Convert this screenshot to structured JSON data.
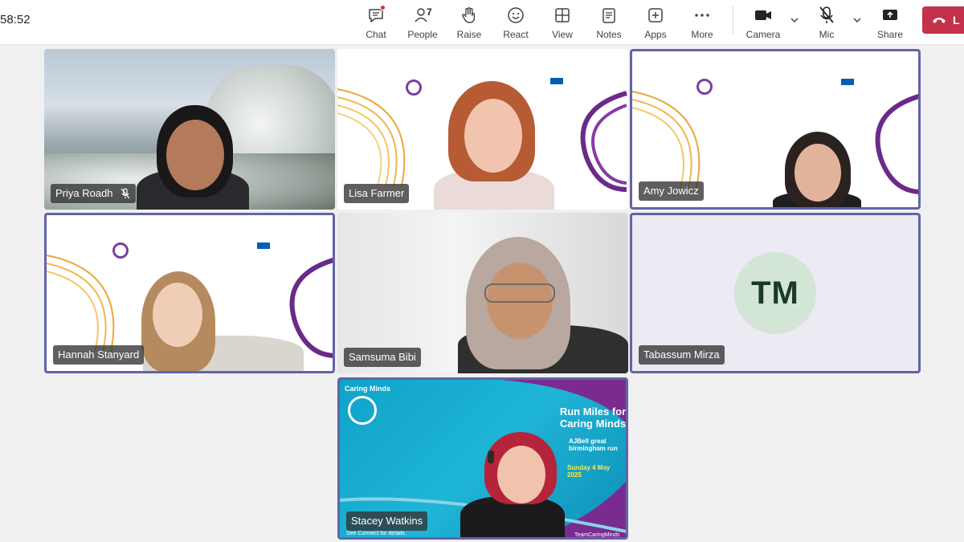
{
  "meeting": {
    "timer": "58:52"
  },
  "toolbar": {
    "chat_label": "Chat",
    "people_label": "People",
    "people_count": "7",
    "raise_label": "Raise",
    "react_label": "React",
    "view_label": "View",
    "notes_label": "Notes",
    "apps_label": "Apps",
    "more_label": "More",
    "camera_label": "Camera",
    "mic_label": "Mic",
    "share_label": "Share",
    "leave_label": "L"
  },
  "participants": [
    {
      "name": "Priya Roadh",
      "muted": true
    },
    {
      "name": "Lisa Farmer",
      "muted": false
    },
    {
      "name": "Amy Jowicz",
      "muted": false
    },
    {
      "name": "Hannah Stanyard",
      "muted": false
    },
    {
      "name": "Samsuma Bibi",
      "muted": false
    },
    {
      "name": "Tabassum Mirza",
      "initials": "TM",
      "muted": false
    },
    {
      "name": "Stacey Watkins",
      "muted": false
    }
  ],
  "stacey_background": {
    "title": "Run Miles for Caring Minds",
    "brand": "AJBell great birmingham run",
    "date": "Sunday 4 May 2025",
    "logo": "Caring Minds",
    "footer_left": "See Connect for details",
    "footer_right": "TeamCaringMinds"
  },
  "colors": {
    "accent": "#6264a7",
    "leave": "#c4314b",
    "notification": "#d13438"
  }
}
